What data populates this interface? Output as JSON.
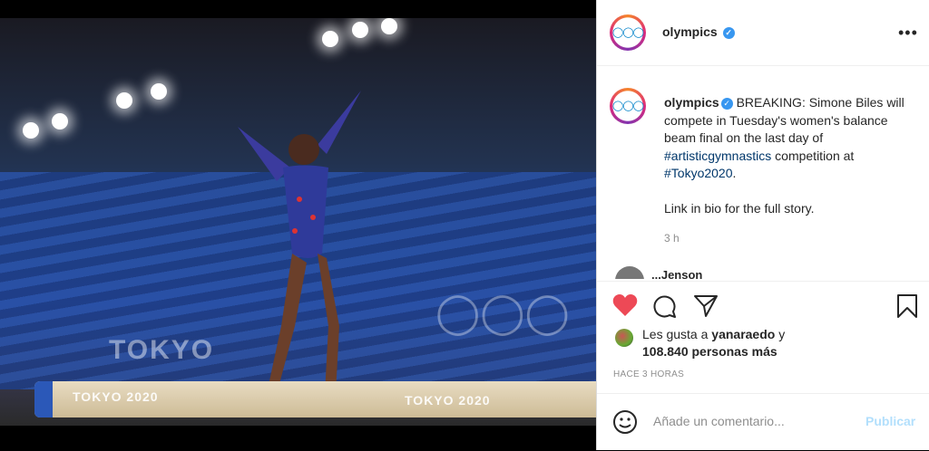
{
  "post": {
    "username": "olympics",
    "verified_mark": "✓",
    "avatar_rings": "◯◯◯",
    "more_options": "•••",
    "caption_user": "olympics",
    "caption_text_1": " BREAKING: Simone Biles will compete in Tuesday's women's balance beam final on the last day of ",
    "hashtag_1": "#artisticgymnastics",
    "caption_text_2": " competition at ",
    "hashtag_2": "#Tokyo2020",
    "caption_text_3": ".",
    "caption_text_4": "Link in bio for the full story.",
    "time_ago_short": "3 h",
    "comment_peek": "...Jenson",
    "likes_prefix": "Les gusta a ",
    "likes_user": "yanaraedo",
    "likes_and": " y",
    "likes_count": "108.840 personas más",
    "posted_ago": "HACE 3 HORAS",
    "comment_placeholder": "Añade un comentario...",
    "publish_label": "Publicar"
  },
  "photo": {
    "beam_label_1": "TOKYO 2020",
    "beam_label_2": "TOKYO 2020",
    "banner_text": "TOKYO",
    "rings": "◯◯◯"
  },
  "icons": {
    "like": "heart-icon",
    "comment": "comment-icon",
    "share": "share-icon",
    "save": "bookmark-icon",
    "emoji": "emoji-icon",
    "more": "more-icon"
  },
  "colors": {
    "like_red": "#ed4956",
    "link_blue": "#00376b",
    "verified_blue": "#3897f0",
    "publish_disabled": "#b2dffc"
  }
}
